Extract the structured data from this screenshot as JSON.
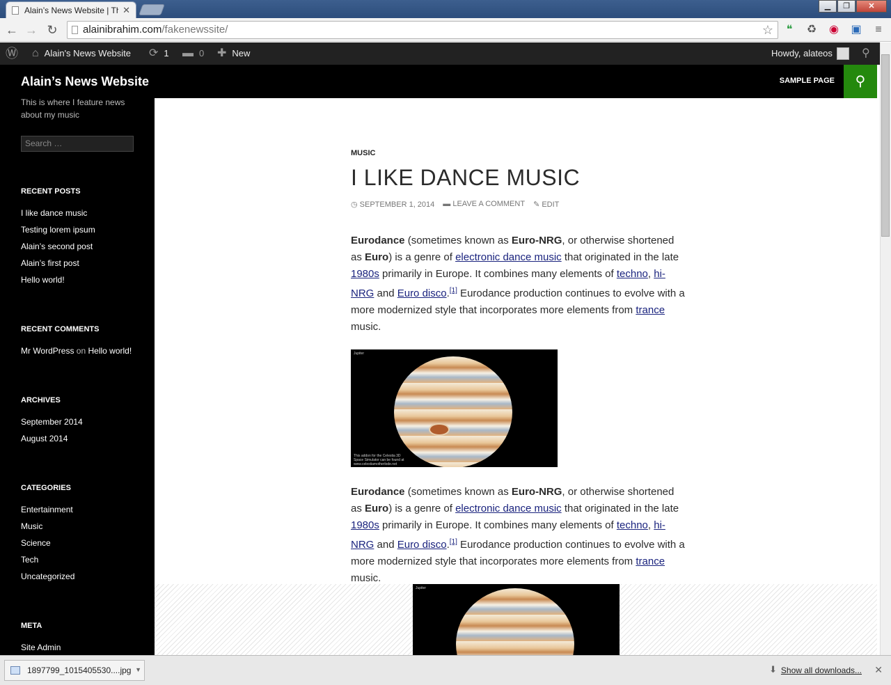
{
  "browser": {
    "tab_title": "Alain’s News Website | Thi",
    "url_domain": "alainibrahim.com",
    "url_path": "/fakenewssite/"
  },
  "adminbar": {
    "site_name": "Alain's News Website",
    "updates_count": "1",
    "comments_count": "0",
    "new_label": "New",
    "howdy": "Howdy, alateos"
  },
  "sidebar": {
    "site_title": "Alain’s News Website",
    "description": "This is where I feature news about my music",
    "search_placeholder": "Search …",
    "recent_posts": {
      "heading": "RECENT POSTS",
      "items": [
        "I like dance music",
        "Testing lorem ipsum",
        "Alain’s second post",
        "Alain’s first post",
        "Hello world!"
      ]
    },
    "recent_comments": {
      "heading": "RECENT COMMENTS",
      "author": "Mr WordPress",
      "on": "on",
      "post": "Hello world!"
    },
    "archives": {
      "heading": "ARCHIVES",
      "items": [
        "September 2014",
        "August 2014"
      ]
    },
    "categories": {
      "heading": "CATEGORIES",
      "items": [
        "Entertainment",
        "Music",
        "Science",
        "Tech",
        "Uncategorized"
      ]
    },
    "meta": {
      "heading": "META",
      "items": [
        "Site Admin"
      ]
    }
  },
  "nav": {
    "sample_page": "SAMPLE PAGE"
  },
  "post": {
    "category": "MUSIC",
    "title": "I LIKE DANCE MUSIC",
    "date": "SEPTEMBER 1, 2014",
    "comment_link": "LEAVE A COMMENT",
    "edit_link": "EDIT",
    "image_caption": "This addon for the Celestia 3D Space Simulator can be found at www.celestiamotherlode.net",
    "image_label": "Jupiter",
    "p": {
      "s1": "Eurodance",
      "s2": " (sometimes known as ",
      "s3": "Euro-NRG",
      "s4": ", or otherwise shortened as ",
      "s5": "Euro",
      "s6": ") is a genre of ",
      "l1": "electronic dance music",
      "s7": " that originated in the late ",
      "l2": "1980s",
      "s8": " primarily in Europe. It combines many elements of ",
      "l3": "techno",
      "s9": ", ",
      "l4": "hi-NRG",
      "s10": " and ",
      "l5": "Euro disco",
      "s11": ".",
      "ref": "[1]",
      "s12": " Eurodance production continues to evolve with a more modernized style that incorporates more elements from ",
      "l6": "trance",
      "s13": " music."
    }
  },
  "downloads": {
    "filename": "1897799_1015405530....jpg",
    "show_all": "Show all downloads..."
  }
}
